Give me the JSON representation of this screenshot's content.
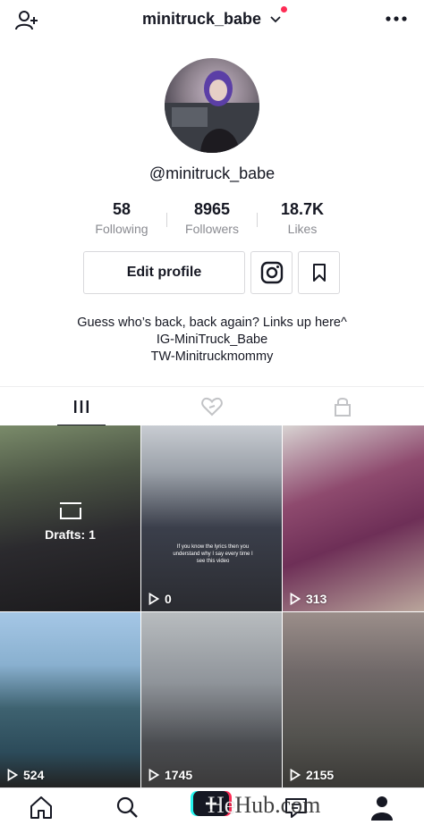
{
  "header": {
    "username_title": "minitruck_babe",
    "add_user_icon": "person-add-icon",
    "more_icon": "ellipsis-icon",
    "notification_dot_color": "#fe2c55"
  },
  "profile": {
    "handle": "@minitruck_babe",
    "stats": [
      {
        "value": "58",
        "label": "Following"
      },
      {
        "value": "8965",
        "label": "Followers"
      },
      {
        "value": "18.7K",
        "label": "Likes"
      }
    ],
    "edit_button": "Edit profile",
    "instagram_icon": "instagram-icon",
    "bookmark_icon": "bookmark-icon",
    "bio": [
      "Guess who’s back, back again? Links up here^",
      "IG-MiniTruck_Babe",
      "TW-Minitruckmommy"
    ]
  },
  "tabs": [
    {
      "icon": "grid-icon",
      "active": true
    },
    {
      "icon": "liked-heart-icon",
      "active": false
    },
    {
      "icon": "lock-icon",
      "active": false
    }
  ],
  "videos": [
    {
      "drafts_label": "Drafts: 1",
      "views": ""
    },
    {
      "views": "0",
      "caption": "If you know the lyrics then you understand why I say every time I see this video"
    },
    {
      "views": "313"
    },
    {
      "views": "524"
    },
    {
      "views": "1745"
    },
    {
      "views": "2155"
    }
  ],
  "watermark": {
    "part1": "He",
    "part2": "Hub.com"
  },
  "nav": [
    {
      "icon": "home-icon"
    },
    {
      "icon": "discover-icon"
    },
    {
      "icon": "plus-icon"
    },
    {
      "icon": "inbox-icon"
    },
    {
      "icon": "profile-icon"
    }
  ]
}
